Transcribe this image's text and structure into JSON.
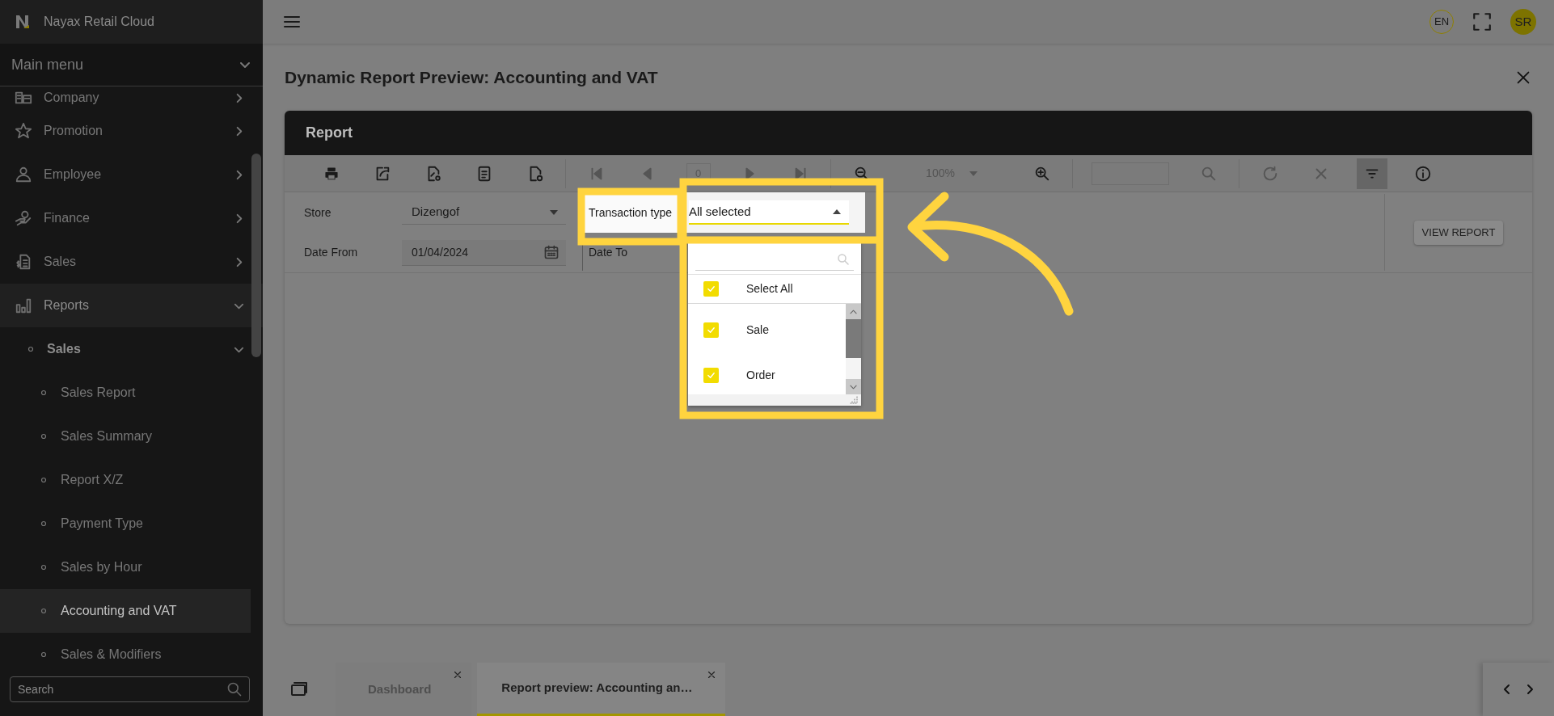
{
  "app": {
    "name": "Nayax Retail Cloud"
  },
  "sidebar": {
    "menu_title": "Main menu",
    "items": [
      {
        "label": "Company",
        "expanded": false
      },
      {
        "label": "Promotion",
        "expanded": false
      },
      {
        "label": "Employee",
        "expanded": false
      },
      {
        "label": "Finance",
        "expanded": false
      },
      {
        "label": "Sales",
        "expanded": false
      },
      {
        "label": "Reports",
        "expanded": true,
        "children": [
          {
            "label": "Sales",
            "expanded": true,
            "children": [
              {
                "label": "Sales Report",
                "selected": false
              },
              {
                "label": "Sales Summary",
                "selected": false
              },
              {
                "label": "Report X/Z",
                "selected": false
              },
              {
                "label": "Payment Type",
                "selected": false
              },
              {
                "label": "Sales by Hour",
                "selected": false
              },
              {
                "label": "Accounting and VAT",
                "selected": true
              },
              {
                "label": "Sales & Modifiers",
                "selected": false
              }
            ]
          }
        ]
      }
    ],
    "search": {
      "placeholder": "Search"
    }
  },
  "header": {
    "language": "EN",
    "user_initials": "SR"
  },
  "page": {
    "title": "Dynamic Report Preview: Accounting and VAT"
  },
  "report": {
    "title": "Report",
    "toolbar": [
      {
        "kind": "print",
        "disabled": false
      },
      {
        "kind": "export",
        "disabled": false
      },
      {
        "kind": "export-settings",
        "disabled": false
      },
      {
        "kind": "document",
        "disabled": false
      },
      {
        "kind": "page-setup",
        "disabled": false
      },
      {
        "kind": "divider"
      },
      {
        "kind": "first",
        "disabled": true
      },
      {
        "kind": "previous",
        "disabled": true
      },
      {
        "kind": "page",
        "value": "0",
        "disabled": true
      },
      {
        "kind": "next",
        "disabled": true
      },
      {
        "kind": "last",
        "disabled": true
      },
      {
        "kind": "divider"
      },
      {
        "kind": "zoom-out",
        "disabled": false
      },
      {
        "kind": "zoom",
        "value": "100%",
        "disabled": true
      },
      {
        "kind": "zoom-in",
        "disabled": false
      },
      {
        "kind": "divider"
      },
      {
        "kind": "search-field"
      },
      {
        "kind": "search",
        "disabled": true
      },
      {
        "kind": "divider"
      },
      {
        "kind": "refresh",
        "disabled": true
      },
      {
        "kind": "cancel",
        "disabled": true
      },
      {
        "kind": "filter",
        "disabled": false,
        "selected": true
      },
      {
        "kind": "info",
        "disabled": false
      }
    ],
    "params": {
      "store": {
        "label": "Store",
        "value": "Dizengof"
      },
      "transaction_type": {
        "label": "Transaction type",
        "value": "All selected",
        "expanded": true
      },
      "date_from": {
        "label": "Date From",
        "value": "01/04/2024"
      },
      "date_to": {
        "label": "Date To"
      },
      "view_button": "VIEW REPORT"
    },
    "dropdown": {
      "options": [
        {
          "kind": "all",
          "label": "Select All",
          "checked": true
        },
        {
          "kind": "option",
          "label": "Sale",
          "checked": true
        },
        {
          "kind": "option",
          "label": "Order",
          "checked": true
        }
      ]
    }
  },
  "tabs": [
    {
      "label": "Dashboard",
      "selected": false
    },
    {
      "label": "Report preview: Accounting an…",
      "selected": true
    }
  ]
}
